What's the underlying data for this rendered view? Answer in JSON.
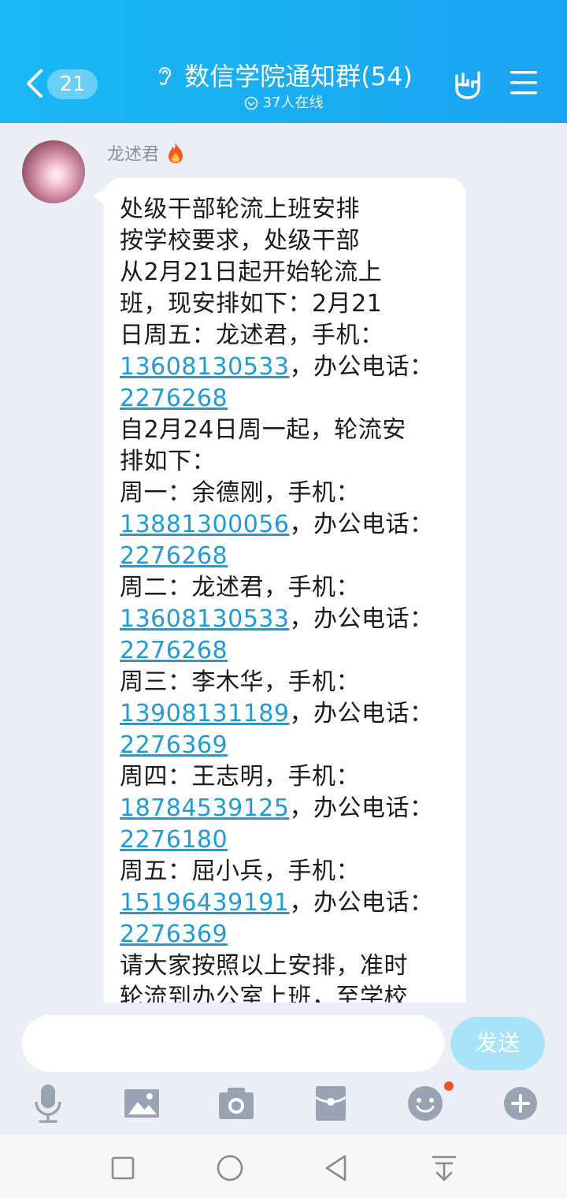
{
  "header": {
    "back_count": "21",
    "title": "数信学院通知群(54)",
    "online": "37人在线",
    "icons": [
      "chevron-left-icon",
      "ear-icon",
      "online-icon",
      "rock-hand-icon",
      "menu-icon"
    ]
  },
  "message": {
    "sender": "龙述君",
    "sender_badge_icon": "fire-icon",
    "lines": [
      {
        "text": "处级干部轮流上班安排"
      },
      {
        "text": "按学校要求，处级干部"
      },
      {
        "text": "从2月21日起开始轮流上"
      },
      {
        "text": "班，现安排如下：2月21"
      },
      {
        "text": "日周五：龙述君，手机："
      },
      {
        "link": "13608130533",
        "text": "，办公电话："
      },
      {
        "link": "2276268"
      },
      {
        "text": "自2月24日周一起，轮流安"
      },
      {
        "text": "排如下："
      },
      {
        "text": "周一：余德刚，手机："
      },
      {
        "link": "13881300056",
        "text": "，办公电话："
      },
      {
        "link": "2276268"
      },
      {
        "text": "周二：龙述君，手机："
      },
      {
        "link": "13608130533",
        "text": "，办公电话："
      },
      {
        "link": "2276268"
      },
      {
        "text": "周三：李木华，手机："
      },
      {
        "link": "13908131189",
        "text": "，办公电话："
      },
      {
        "link": "2276369"
      },
      {
        "text": "周四：王志明，手机："
      },
      {
        "link": "18784539125",
        "text": "，办公电话："
      },
      {
        "link": "2276180"
      },
      {
        "text": "周五：屈小兵，手机："
      },
      {
        "link": "15196439191",
        "text": "，办公电话："
      },
      {
        "link": "2276369"
      },
      {
        "text": "请大家按照以上安排，准时"
      },
      {
        "text": "轮流到办公室上班，至学校"
      }
    ]
  },
  "input": {
    "value": "",
    "send_label": "发送"
  },
  "toolbar": [
    "mic-icon",
    "image-icon",
    "camera-icon",
    "red-packet-icon",
    "emoji-icon",
    "plus-icon"
  ],
  "navbar": [
    "recent-apps-icon",
    "home-icon",
    "back-icon",
    "notification-pull-icon"
  ],
  "colors": {
    "header": "#1aabf2",
    "link": "#1f9bd6",
    "send_button": "#a9e3f9",
    "background": "#eceef5"
  }
}
